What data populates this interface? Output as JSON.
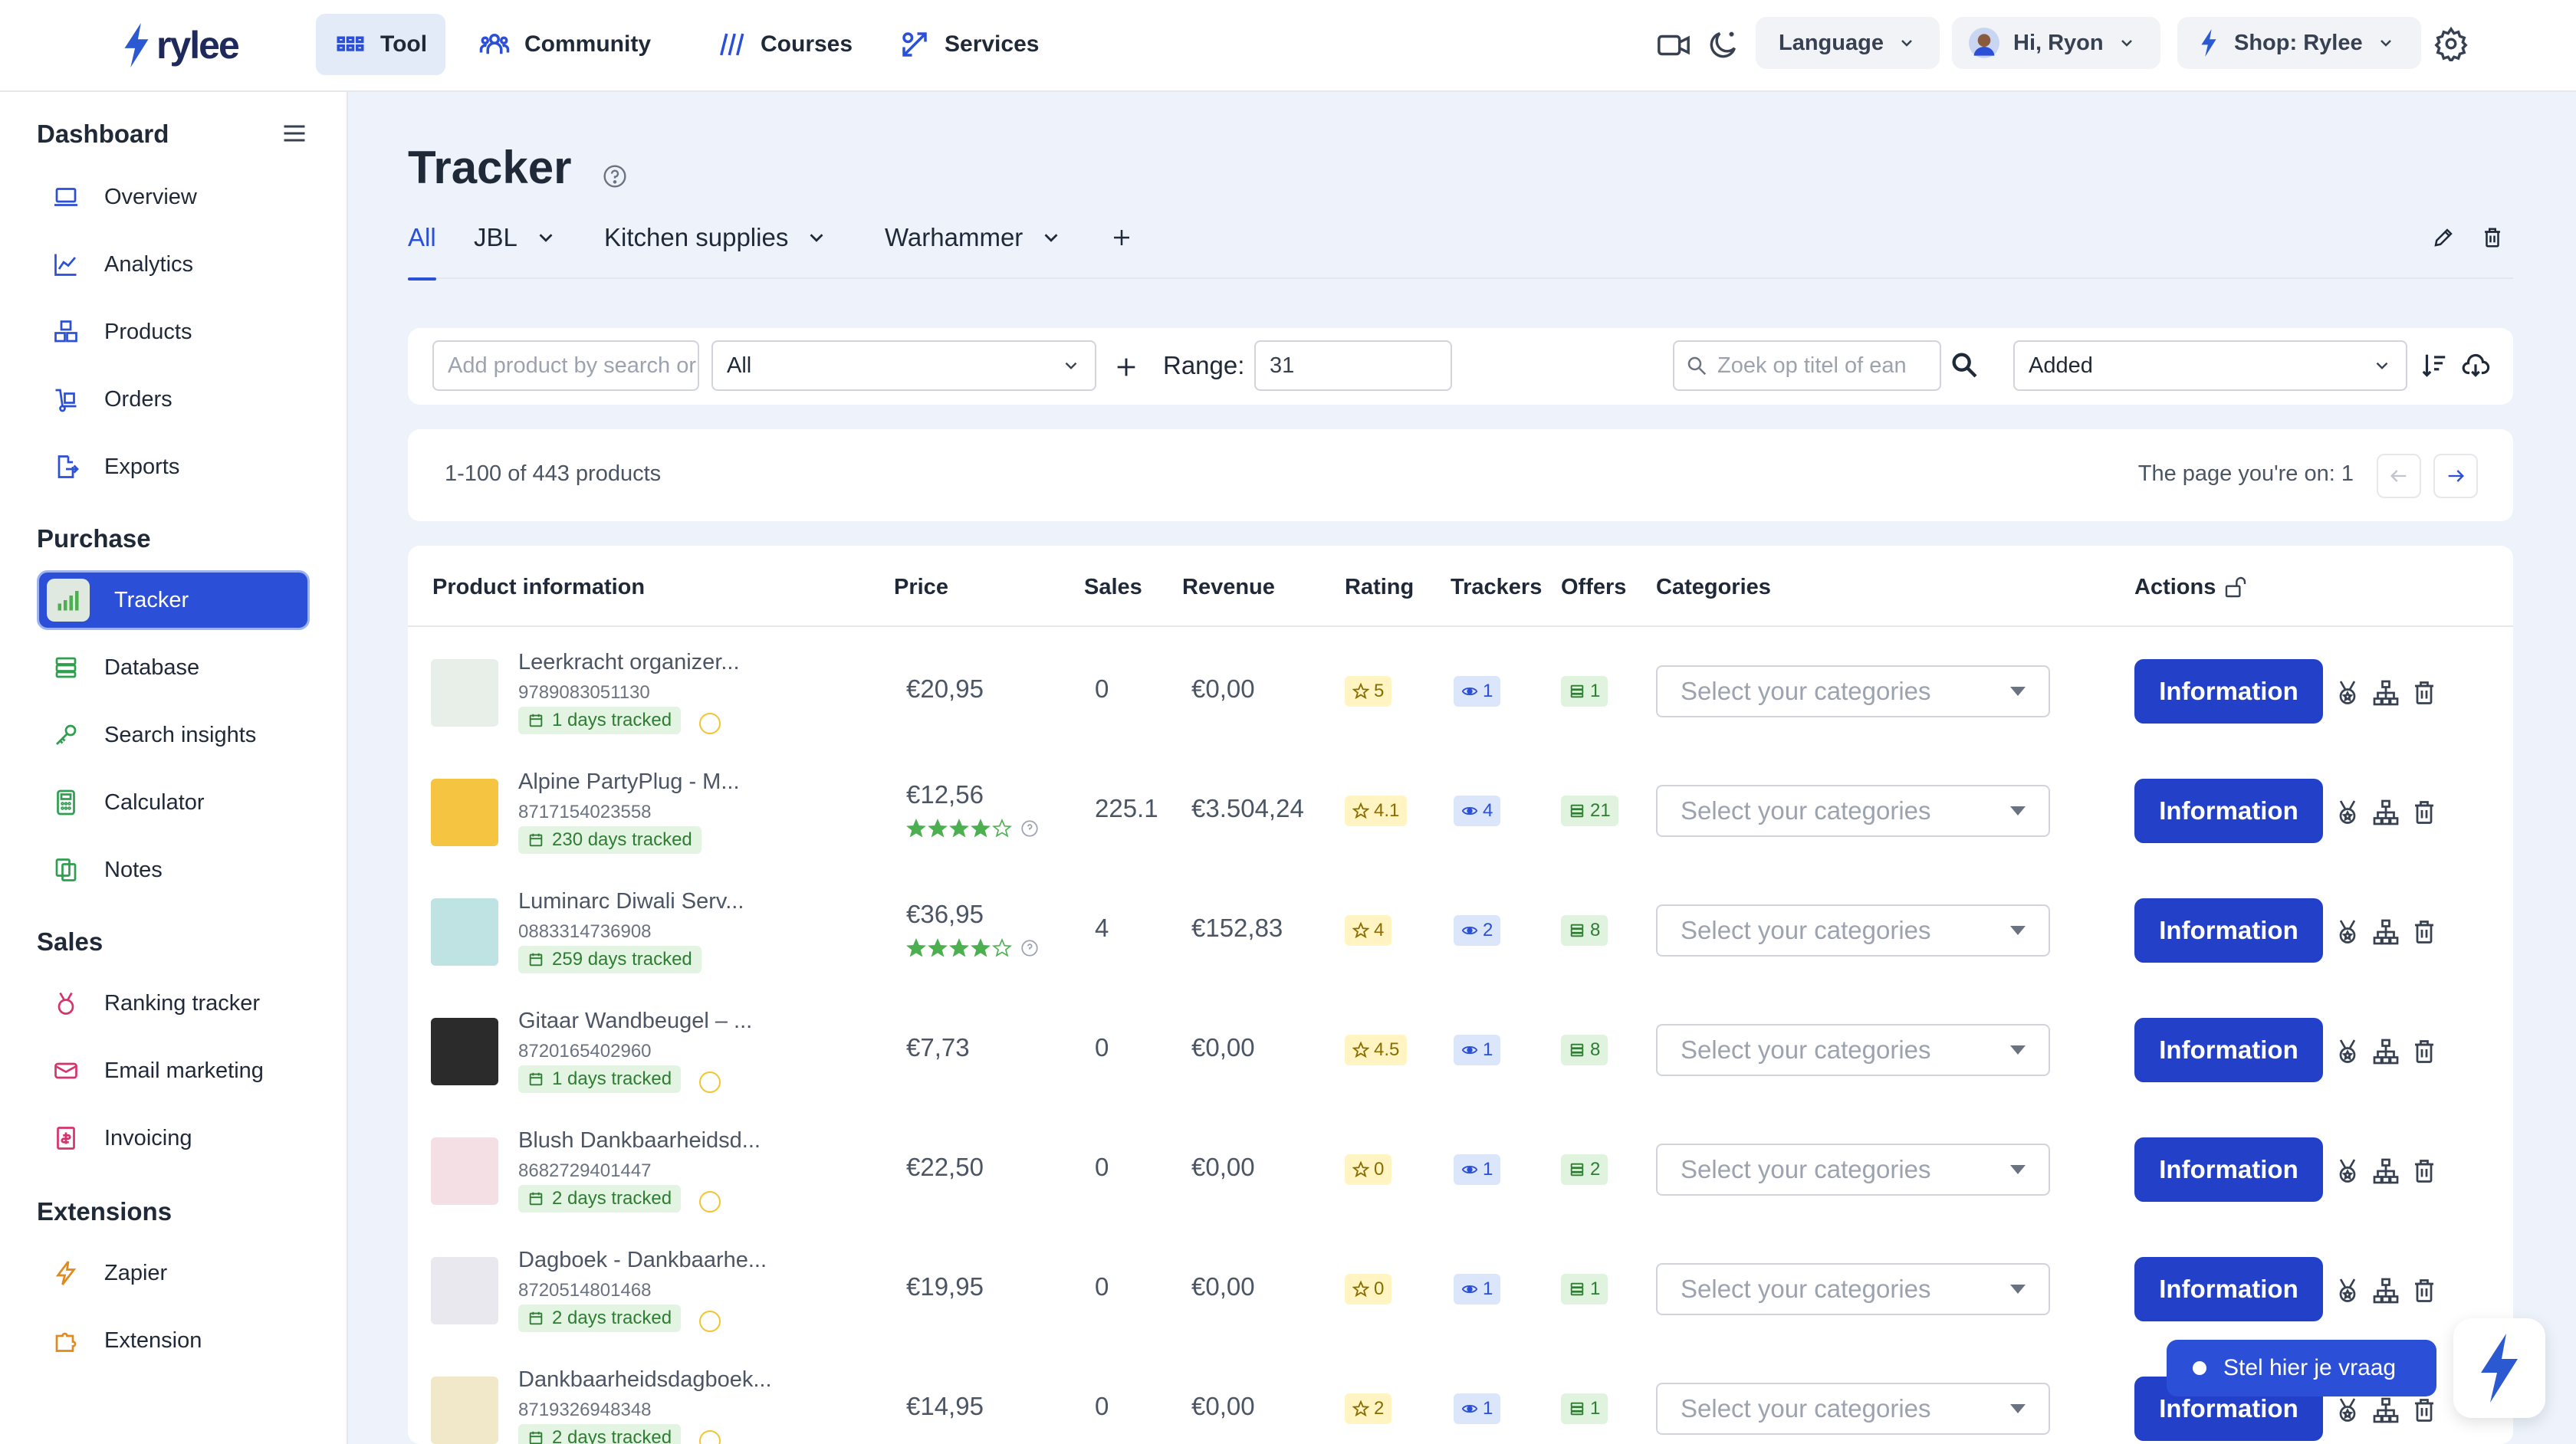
{
  "brand": {
    "name": "rylee",
    "accent": "#2b4fd6"
  },
  "nav": {
    "tool": "Tool",
    "community": "Community",
    "courses": "Courses",
    "services": "Services",
    "language": "Language",
    "user": "Hi, Ryon",
    "shop": "Shop: Rylee"
  },
  "sidebar": {
    "dashboard_heading": "Dashboard",
    "dashboard": [
      "Overview",
      "Analytics",
      "Products",
      "Orders",
      "Exports"
    ],
    "purchase_heading": "Purchase",
    "purchase": [
      "Tracker",
      "Database",
      "Search insights",
      "Calculator",
      "Notes"
    ],
    "sales_heading": "Sales",
    "sales": [
      "Ranking tracker",
      "Email marketing",
      "Invoicing"
    ],
    "extensions_heading": "Extensions",
    "extensions": [
      "Zapier",
      "Extension"
    ]
  },
  "page": {
    "title": "Tracker"
  },
  "tabs": [
    "All",
    "JBL",
    "Kitchen supplies",
    "Warhammer"
  ],
  "filters": {
    "add_product_placeholder": "Add product by search or EAN",
    "group_value": "All",
    "range_label": "Range:",
    "range_value": "31",
    "search_placeholder": "Zoek op titel of ean",
    "sort_value": "Added"
  },
  "pagination": {
    "count": "1-100 of 443 products",
    "page_text": "The page you're on: 1"
  },
  "table": {
    "headers": [
      "Product information",
      "Price",
      "Sales",
      "Revenue",
      "Rating",
      "Trackers",
      "Offers",
      "Categories",
      "Actions"
    ],
    "category_placeholder": "Select your categories",
    "action_label": "Information",
    "rows": [
      {
        "name": "Leerkracht organizer...",
        "ean": "9789083051130",
        "tracked": "1 days tracked",
        "warn": true,
        "price": "€20,95",
        "stars": 0,
        "sales": "0",
        "revenue": "€0,00",
        "rating": "5",
        "trackers": "1",
        "offers": "1"
      },
      {
        "name": "Alpine PartyPlug - M...",
        "ean": "8717154023558",
        "tracked": "230 days tracked",
        "warn": false,
        "price": "€12,56",
        "stars": 4,
        "sales": "225.1",
        "revenue": "€3.504,24",
        "rating": "4.1",
        "trackers": "4",
        "offers": "21"
      },
      {
        "name": "Luminarc Diwali Serv...",
        "ean": "0883314736908",
        "tracked": "259 days tracked",
        "warn": false,
        "price": "€36,95",
        "stars": 4,
        "sales": "4",
        "revenue": "€152,83",
        "rating": "4",
        "trackers": "2",
        "offers": "8"
      },
      {
        "name": "Gitaar Wandbeugel – ...",
        "ean": "8720165402960",
        "tracked": "1 days tracked",
        "warn": true,
        "price": "€7,73",
        "stars": 0,
        "sales": "0",
        "revenue": "€0,00",
        "rating": "4.5",
        "trackers": "1",
        "offers": "8"
      },
      {
        "name": "Blush Dankbaarheidsd...",
        "ean": "8682729401447",
        "tracked": "2 days tracked",
        "warn": true,
        "price": "€22,50",
        "stars": 0,
        "sales": "0",
        "revenue": "€0,00",
        "rating": "0",
        "trackers": "1",
        "offers": "2"
      },
      {
        "name": "Dagboek - Dankbaarhe...",
        "ean": "8720514801468",
        "tracked": "2 days tracked",
        "warn": true,
        "price": "€19,95",
        "stars": 0,
        "sales": "0",
        "revenue": "€0,00",
        "rating": "0",
        "trackers": "1",
        "offers": "1"
      },
      {
        "name": "Dankbaarheidsdagboek...",
        "ean": "8719326948348",
        "tracked": "2 days tracked",
        "warn": true,
        "price": "€14,95",
        "stars": 0,
        "sales": "0",
        "revenue": "€0,00",
        "rating": "2",
        "trackers": "1",
        "offers": "1"
      }
    ]
  },
  "chat": {
    "label": "Stel hier je vraag"
  }
}
